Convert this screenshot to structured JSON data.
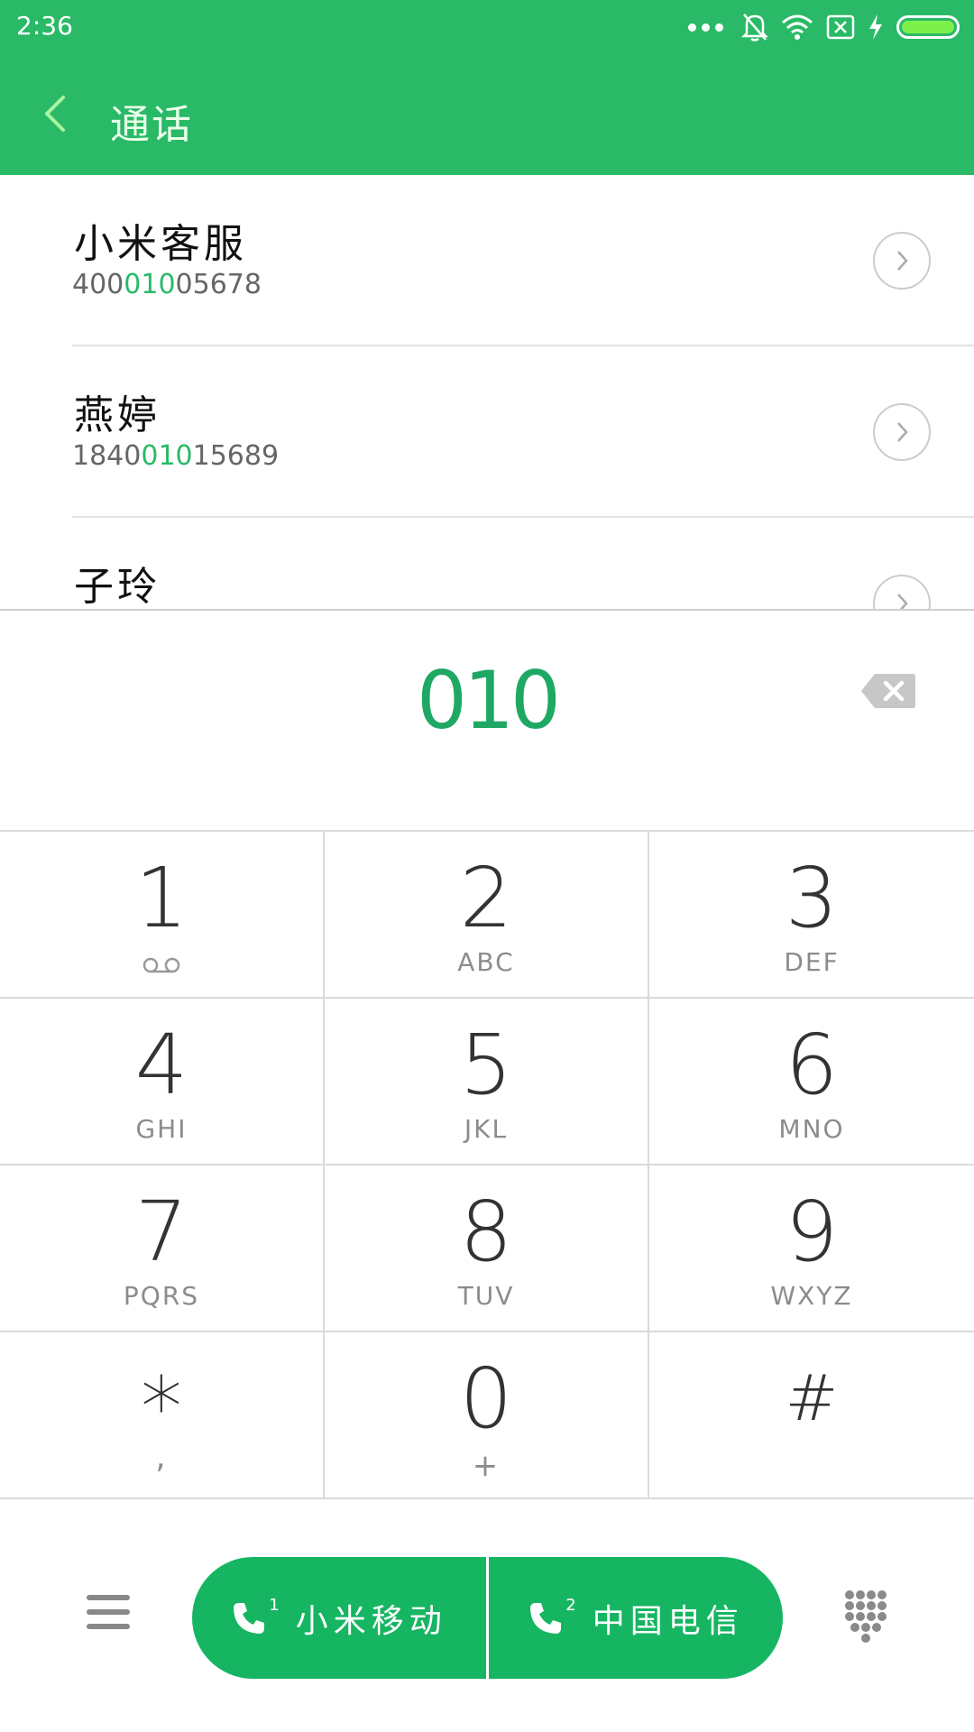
{
  "status_bar": {
    "time": "2:36"
  },
  "header": {
    "title": "通话"
  },
  "results": [
    {
      "name": "小米客服",
      "number_parts": [
        "400",
        "010",
        "05678"
      ]
    },
    {
      "name": "燕婷",
      "number_parts": [
        "1840",
        "010",
        "15689"
      ]
    },
    {
      "name": "子玲",
      "number_parts": [
        "",
        "",
        ""
      ]
    }
  ],
  "dialer": {
    "number": "010"
  },
  "keypad": [
    {
      "digit": "1",
      "letters": ""
    },
    {
      "digit": "2",
      "letters": "ABC"
    },
    {
      "digit": "3",
      "letters": "DEF"
    },
    {
      "digit": "4",
      "letters": "GHI"
    },
    {
      "digit": "5",
      "letters": "JKL"
    },
    {
      "digit": "6",
      "letters": "MNO"
    },
    {
      "digit": "7",
      "letters": "PQRS"
    },
    {
      "digit": "8",
      "letters": "TUV"
    },
    {
      "digit": "9",
      "letters": "WXYZ"
    },
    {
      "digit": "*",
      "letters": ","
    },
    {
      "digit": "0",
      "letters": "+"
    },
    {
      "digit": "#",
      "letters": ""
    }
  ],
  "call_buttons": [
    {
      "sim": "1",
      "label": "小米移动"
    },
    {
      "sim": "2",
      "label": "中国电信"
    }
  ],
  "colors": {
    "accent": "#2aba67",
    "call_button": "#16b562",
    "highlight": "#1fa864"
  }
}
